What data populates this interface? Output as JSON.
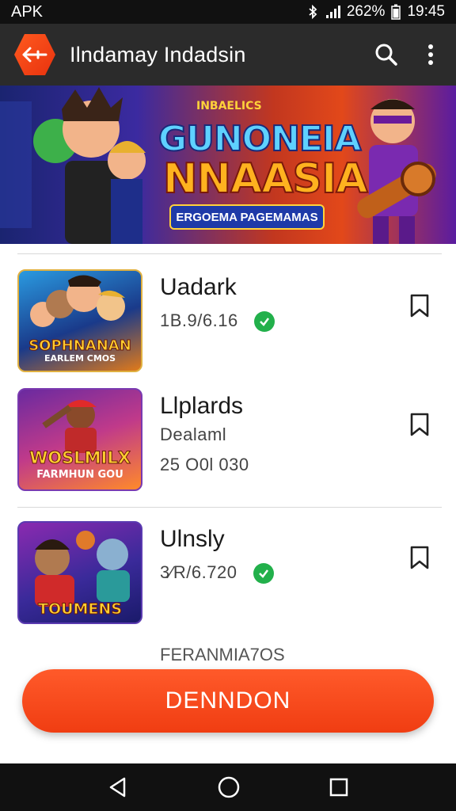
{
  "status_bar": {
    "left_label": "APK",
    "battery": "262%",
    "time": "19:45"
  },
  "app_bar": {
    "title": "Ilndamay Indadsin"
  },
  "banner": {
    "small_text": "INBAELICS",
    "title_line1": "GUNONEIA",
    "title_line2": "NNAASIA",
    "subtitle": "ERGOEMA PAGEMAMAS"
  },
  "items": [
    {
      "title": "Uadark",
      "line1": "1B.9/6.16",
      "line2": "",
      "verified": true,
      "thumb_text": "SOPHNANAN",
      "thumb_sub": "EARLEM CMOS"
    },
    {
      "title": "Llplards",
      "line1": "Dealaml",
      "line2": "25 O0l 030",
      "verified": false,
      "thumb_text": "WOSLMILX",
      "thumb_sub": "FARMHUN GOU"
    },
    {
      "title": "Ulnsly",
      "line1": "3∕R/6.720",
      "line2": "",
      "verified": true,
      "thumb_text": "TOUMENS",
      "thumb_sub": ""
    }
  ],
  "footer_label": "FERANMIA7OS",
  "cta": {
    "label": "DENNDON"
  },
  "colors": {
    "accent": "#f03d12",
    "verified": "#22b04b",
    "app_bar": "#2b2b2b"
  }
}
